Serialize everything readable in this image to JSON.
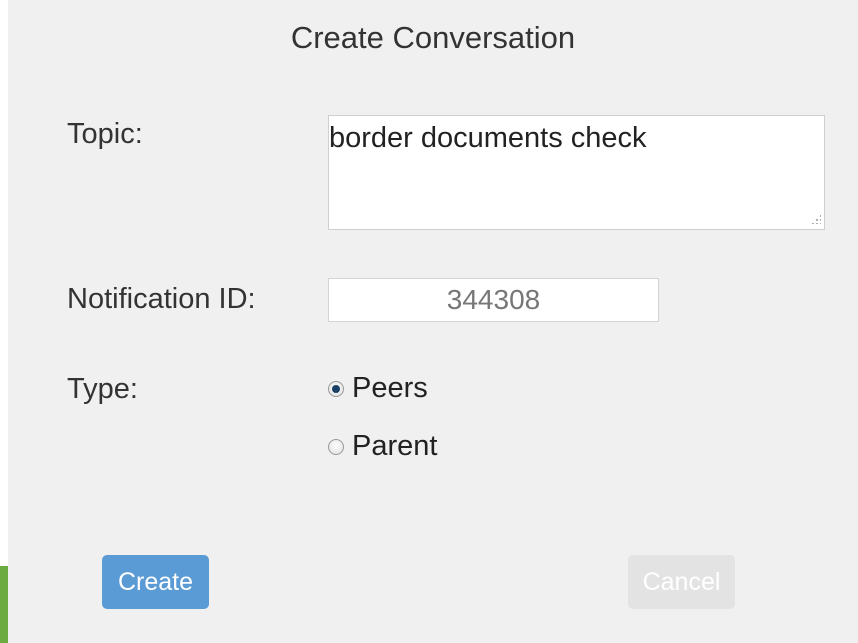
{
  "dialog": {
    "title": "Create Conversation",
    "topic": {
      "label": "Topic:",
      "value": "border documents check"
    },
    "notification": {
      "label": "Notification ID:",
      "value": "344308"
    },
    "type": {
      "label": "Type:",
      "options": [
        {
          "label": "Peers",
          "checked": true
        },
        {
          "label": "Parent",
          "checked": false
        }
      ]
    },
    "buttons": {
      "create_label": "Create",
      "cancel_label": "Cancel"
    }
  },
  "colors": {
    "dialog_bg": "#f0f0f0",
    "primary_button": "#5b9bd5",
    "disabled_button": "#e3e3e3",
    "accent_strip": "#6bab3f"
  }
}
